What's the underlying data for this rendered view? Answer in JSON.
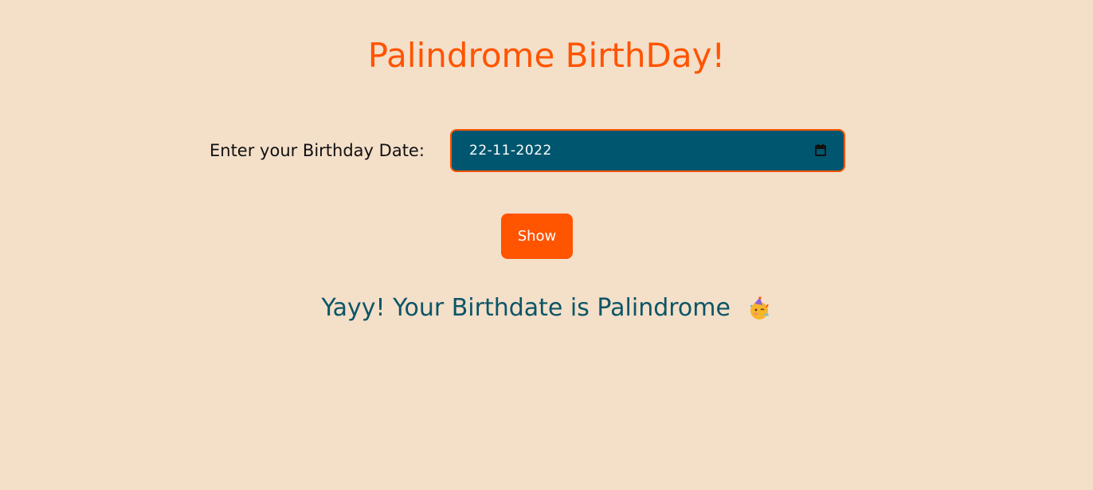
{
  "title": "Palindrome BirthDay!",
  "form": {
    "label": "Enter your Birthday Date:",
    "date_value": "22-11-2022",
    "calendar_icon": "calendar-icon",
    "button_label": "Show"
  },
  "result": {
    "message": "Yayy! Your Birthdate is Palindrome",
    "emoji_icon": "party-face-emoji"
  },
  "colors": {
    "background": "#f4dfc9",
    "accent": "#ff5400",
    "input_background": "#00566e",
    "result_text": "#0b5566"
  }
}
